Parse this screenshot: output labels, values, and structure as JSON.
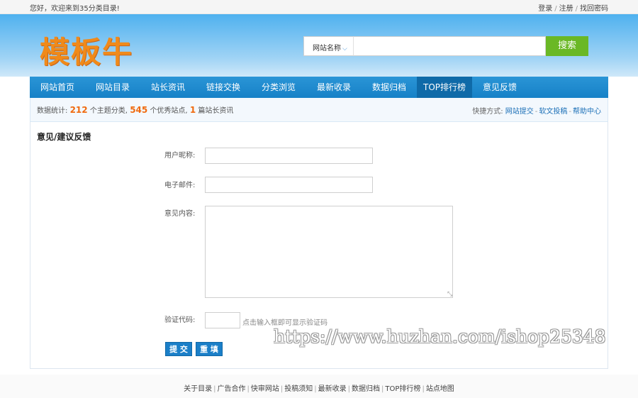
{
  "topbar": {
    "welcome": "您好，欢迎来到35分类目录!",
    "login": "登录",
    "register": "注册",
    "find_password": "找回密码"
  },
  "header": {
    "logo_text": "模板牛",
    "search": {
      "selected_option": "网站名称",
      "input_value": "",
      "button_label": "搜索"
    }
  },
  "nav": {
    "items": [
      {
        "label": "网站首页"
      },
      {
        "label": "网站目录"
      },
      {
        "label": "站长资讯"
      },
      {
        "label": "链接交换"
      },
      {
        "label": "分类浏览"
      },
      {
        "label": "最新收录"
      },
      {
        "label": "数据归档"
      },
      {
        "label": "TOP排行榜"
      },
      {
        "label": "意见反馈"
      }
    ],
    "active_index": 7
  },
  "stats": {
    "prefix": "数据统计:",
    "categories_count": "212",
    "categories_text": "个主题分类,",
    "sites_count": "545",
    "sites_text": "个优秀站点,",
    "articles_count": "1",
    "articles_text": "篇站长资讯",
    "shortcut_label": "快捷方式:",
    "shortcuts": [
      "网站提交",
      "软文投稿",
      "帮助中心"
    ]
  },
  "feedback": {
    "title": "意见/建议反馈",
    "nickname_label": "用户昵称:",
    "nickname_value": "",
    "email_label": "电子邮件:",
    "email_value": "",
    "content_label": "意见内容:",
    "content_value": "",
    "captcha_label": "验证代码:",
    "captcha_value": "",
    "captcha_hint": "点击输入框即可显示验证码",
    "submit_label": "提 交",
    "reset_label": "重 填"
  },
  "watermark": "https://www.huzhan.com/ishop25348",
  "footer": {
    "links": [
      "关于目录",
      "广告合作",
      "快审网站",
      "投稿须知",
      "最新收录",
      "数据归档",
      "TOP排行榜",
      "站点地图"
    ]
  },
  "colors": {
    "nav_bg": "#1681c7",
    "nav_active": "#0f6aa8",
    "logo": "#f08a1a",
    "search_button": "#6ab825",
    "stat_number": "#f06a0f",
    "link": "#1b6fb7"
  }
}
